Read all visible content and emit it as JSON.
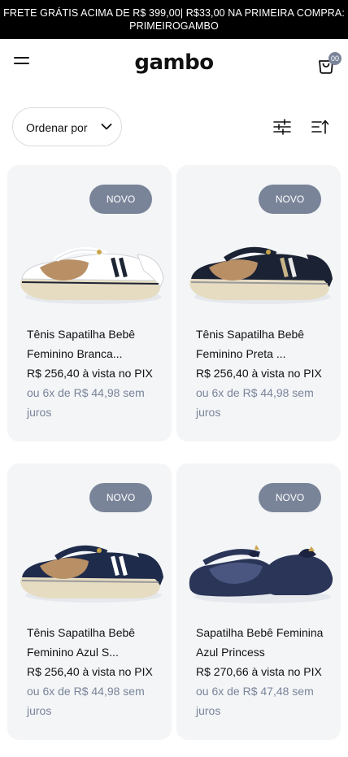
{
  "promo": {
    "line1": "FRETE GRÁTIS ACIMA DE R$ 399,00| R$33,00 NA PRIMEIRA COMPRA:",
    "line2": "PRIMEIROGAMBO"
  },
  "header": {
    "logo": "gambo",
    "cart_count": "00",
    "menu_icon": "hamburger-icon",
    "cart_icon": "shopping-bag-icon"
  },
  "toolbar": {
    "sort_label": "Ordenar por",
    "filter_icon": "sliders-icon",
    "order_icon": "sort-ascending-icon"
  },
  "colors": {
    "promo_bg": "#000000",
    "badge_bg": "#7a8499",
    "card_bg": "#f3f5f7",
    "muted_text": "#7a8499"
  },
  "products": [
    {
      "badge": "NOVO",
      "name": "Tênis Sapatilha Bebê Feminino Branca...",
      "price": "R$ 256,40 à vista no PIX",
      "installments": "ou 6x de R$ 44,98 sem juros"
    },
    {
      "badge": "NOVO",
      "name": "Tênis Sapatilha Bebê Feminino Preta ...",
      "price": "R$ 256,40 à vista no PIX",
      "installments": "ou 6x de R$ 44,98 sem juros"
    },
    {
      "badge": "NOVO",
      "name": "Tênis Sapatilha Bebê Feminino Azul S...",
      "price": "R$ 256,40 à vista no PIX",
      "installments": "ou 6x de R$ 44,98 sem juros"
    },
    {
      "badge": "NOVO",
      "name": "Sapatilha Bebê Feminina Azul Princess",
      "price": "R$ 270,66 à vista no PIX",
      "installments": "ou 6x de R$ 47,48 sem juros"
    }
  ]
}
